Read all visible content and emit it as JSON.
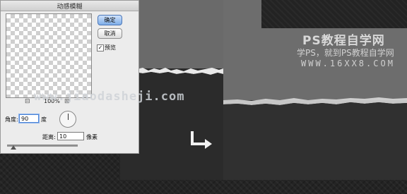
{
  "dialog": {
    "title": "动感模糊",
    "ok_label": "确定",
    "cancel_label": "取消",
    "preview_label": "预览",
    "preview_checked": true,
    "zoom_minus": "⊟",
    "zoom_level": "100%",
    "zoom_plus": "⊞",
    "angle_label": "角度:",
    "angle_value": "90",
    "angle_unit": "度",
    "distance_label": "距离:",
    "distance_value": "10",
    "distance_unit": "像素"
  },
  "overlay_url": "www.jiaodasheji.com",
  "watermark": {
    "title": "PS教程自学网",
    "subtitle": "学PS，就到PS教程自学网",
    "url": "WWW.16XX8.COM"
  },
  "icons": {
    "arrow": "turn-right-arrow-icon",
    "check": "checkmark-icon",
    "dial": "angle-dial-icon",
    "slider": "slider-thumb-icon"
  },
  "colors": {
    "default_button": "#7faee8",
    "focus_ring": "#4f86d6",
    "background": "#242424"
  }
}
